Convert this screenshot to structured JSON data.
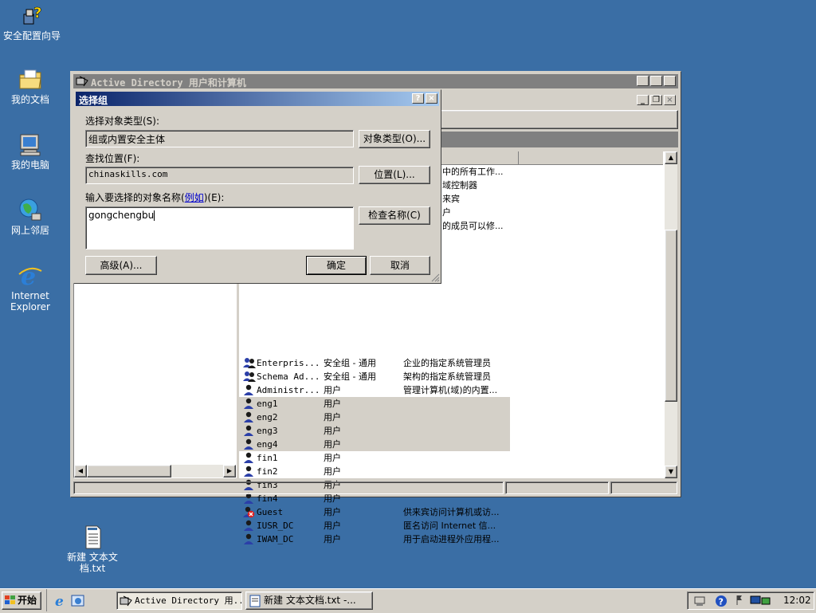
{
  "desktop": {
    "icons": [
      {
        "label": "安全配置向导"
      },
      {
        "label": "我的文档"
      },
      {
        "label": "我的电脑"
      },
      {
        "label": "网上邻居"
      },
      {
        "label": "Internet Explorer"
      },
      {
        "label": "新建 文本文档.txt"
      }
    ]
  },
  "main_window": {
    "title": "Active Directory 用户和计算机",
    "list_partial": [
      "中的所有工作...",
      "域控制器",
      "来宾",
      "户",
      "的成员可以修..."
    ],
    "rows": [
      {
        "name": "Enterpris...",
        "type": "安全组 - 通用",
        "desc": "企业的指定系统管理员",
        "icon": "group-icon",
        "selected": false
      },
      {
        "name": "Schema Ad...",
        "type": "安全组 - 通用",
        "desc": "架构的指定系统管理员",
        "icon": "group-icon",
        "selected": false
      },
      {
        "name": "Administr...",
        "type": "用户",
        "desc": "管理计算机(域)的内置...",
        "icon": "user-icon",
        "selected": false
      },
      {
        "name": "eng1",
        "type": "用户",
        "desc": "",
        "icon": "user-icon",
        "selected": true
      },
      {
        "name": "eng2",
        "type": "用户",
        "desc": "",
        "icon": "user-icon",
        "selected": true
      },
      {
        "name": "eng3",
        "type": "用户",
        "desc": "",
        "icon": "user-icon",
        "selected": true
      },
      {
        "name": "eng4",
        "type": "用户",
        "desc": "",
        "icon": "user-icon",
        "selected": true
      },
      {
        "name": "fin1",
        "type": "用户",
        "desc": "",
        "icon": "user-icon",
        "selected": false
      },
      {
        "name": "fin2",
        "type": "用户",
        "desc": "",
        "icon": "user-icon",
        "selected": false
      },
      {
        "name": "fin3",
        "type": "用户",
        "desc": "",
        "icon": "user-icon",
        "selected": false
      },
      {
        "name": "fin4",
        "type": "用户",
        "desc": "",
        "icon": "user-icon",
        "selected": false
      },
      {
        "name": "Guest",
        "type": "用户",
        "desc": "供来宾访问计算机或访...",
        "icon": "disabled-user-icon",
        "selected": false
      },
      {
        "name": "IUSR_DC",
        "type": "用户",
        "desc": "匿名访问 Internet 信...",
        "icon": "user-icon",
        "selected": false
      },
      {
        "name": "IWAM_DC",
        "type": "用户",
        "desc": "用于启动进程外应用程...",
        "icon": "user-icon",
        "selected": false
      }
    ]
  },
  "dialog": {
    "title": "选择组",
    "object_type_label": "选择对象类型(S):",
    "object_type_value": "组或内置安全主体",
    "object_type_button": "对象类型(O)...",
    "location_label": "查找位置(F):",
    "location_value": "chinaskills.com",
    "location_button": "位置(L)...",
    "names_label_pre": "输入要选择的对象名称(",
    "names_label_link": "例如",
    "names_label_post": ")(E):",
    "names_value": "gongchengbu",
    "check_names_button": "检查名称(C)",
    "advanced_button": "高级(A)...",
    "ok_button": "确定",
    "cancel_button": "取消"
  },
  "taskbar": {
    "start_label": "开始",
    "tasks": [
      {
        "label": "Active Directory 用..."
      },
      {
        "label": "新建 文本文档.txt -..."
      }
    ],
    "clock": "12:02"
  }
}
